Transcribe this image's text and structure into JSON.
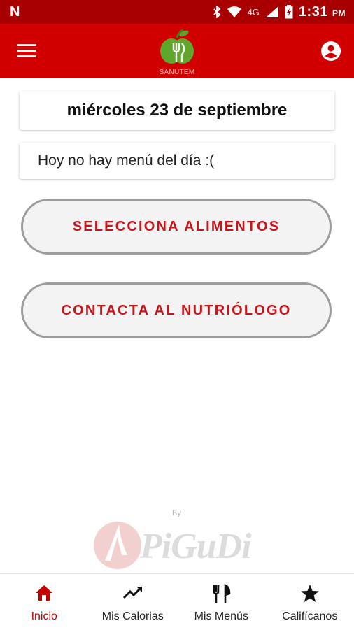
{
  "status_bar": {
    "time": "1:31",
    "meridiem": "PM",
    "network": "4G"
  },
  "app_bar": {
    "logo_text": "SANUTEM",
    "background": "#d10000"
  },
  "main": {
    "date_title": "miércoles 23 de septiembre",
    "menu_message": "Hoy no hay menú del día :(",
    "buttons": {
      "select_foods": "SELECCIONA ALIMENTOS",
      "contact_nutritionist": "CONTACTA AL NUTRIÓLOGO"
    }
  },
  "watermark": {
    "by": "By",
    "brand": "PiGuDi"
  },
  "bottom_nav": {
    "items": [
      {
        "label": "Inicio",
        "icon": "home-icon",
        "active": true
      },
      {
        "label": "Mis Calorias",
        "icon": "trending-up-icon",
        "active": false
      },
      {
        "label": "Mis Menús",
        "icon": "restaurant-icon",
        "active": false
      },
      {
        "label": "Califícanos",
        "icon": "star-icon",
        "active": false
      }
    ]
  },
  "colors": {
    "primary": "#d10000",
    "status_bar": "#a80000",
    "accent_text": "#c9141a"
  }
}
